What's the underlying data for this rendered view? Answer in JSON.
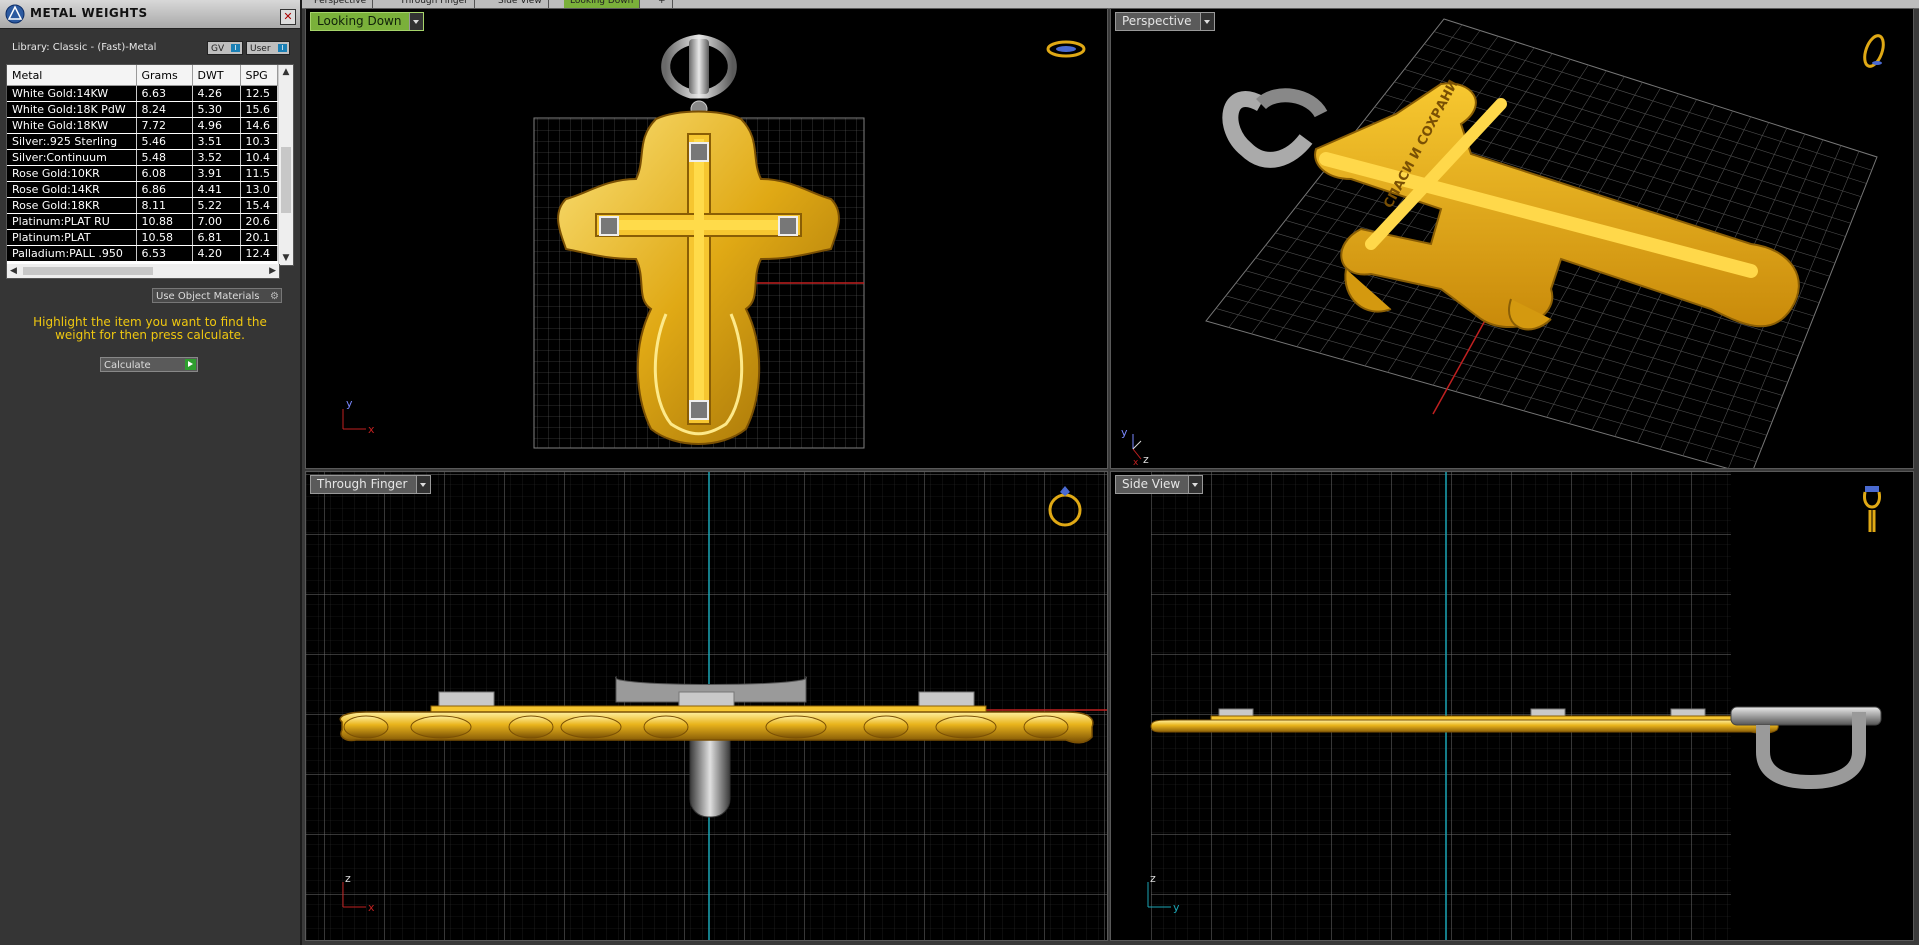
{
  "panel": {
    "title": "METAL WEIGHTS",
    "close_glyph": "✕",
    "library_label": "Library: Classic - (Fast)-Metal",
    "toggle_gv": "GV",
    "toggle_user": "User",
    "columns": [
      "Metal",
      "Grams",
      "DWT",
      "SPG"
    ],
    "rows": [
      {
        "metal": "White Gold:14KW",
        "grams": "6.63",
        "dwt": "4.26",
        "spg": "12.5"
      },
      {
        "metal": "White Gold:18K PdW",
        "grams": "8.24",
        "dwt": "5.30",
        "spg": "15.6"
      },
      {
        "metal": "White Gold:18KW",
        "grams": "7.72",
        "dwt": "4.96",
        "spg": "14.6"
      },
      {
        "metal": "Silver:.925 Sterling",
        "grams": "5.46",
        "dwt": "3.51",
        "spg": "10.3"
      },
      {
        "metal": "Silver:Continuum",
        "grams": "5.48",
        "dwt": "3.52",
        "spg": "10.4"
      },
      {
        "metal": "Rose Gold:10KR",
        "grams": "6.08",
        "dwt": "3.91",
        "spg": "11.5"
      },
      {
        "metal": "Rose Gold:14KR",
        "grams": "6.86",
        "dwt": "4.41",
        "spg": "13.0"
      },
      {
        "metal": "Rose Gold:18KR",
        "grams": "8.11",
        "dwt": "5.22",
        "spg": "15.4"
      },
      {
        "metal": "Platinum:PLAT RU",
        "grams": "10.88",
        "dwt": "7.00",
        "spg": "20.6"
      },
      {
        "metal": "Platinum:PLAT",
        "grams": "10.58",
        "dwt": "6.81",
        "spg": "20.1"
      },
      {
        "metal": "Palladium:PALL .950",
        "grams": "6.53",
        "dwt": "4.20",
        "spg": "12.4"
      }
    ],
    "use_object_materials": "Use Object Materials",
    "hint": "Highlight the item you want to find the weight for then press calculate.",
    "calculate_label": "Calculate"
  },
  "tabs": [
    "Perspective",
    "Through Finger",
    "Side View",
    "Looking Down",
    "+"
  ],
  "viewports": {
    "top": {
      "label": "Looking Down",
      "axis_a": "y",
      "axis_b": "x"
    },
    "perspective": {
      "label": "Perspective",
      "axis_a": "y",
      "axis_b": "z",
      "axis_c": "x"
    },
    "front": {
      "label": "Through Finger",
      "axis_a": "z",
      "axis_b": "x"
    },
    "side": {
      "label": "Side View",
      "axis_a": "z",
      "axis_b": "y"
    }
  },
  "perspective_engraving": "СПАСИ И СОХРАНИ",
  "colors": {
    "gold": "#e0a915",
    "gold_light": "#f7d24a",
    "gold_dark": "#8a5e05",
    "silver": "#b9b9b9",
    "grid": "#6b6b6b",
    "axis_x": "#c02020",
    "axis_y": "#1aa5b5",
    "highlight_yellow": "#f0c810"
  }
}
